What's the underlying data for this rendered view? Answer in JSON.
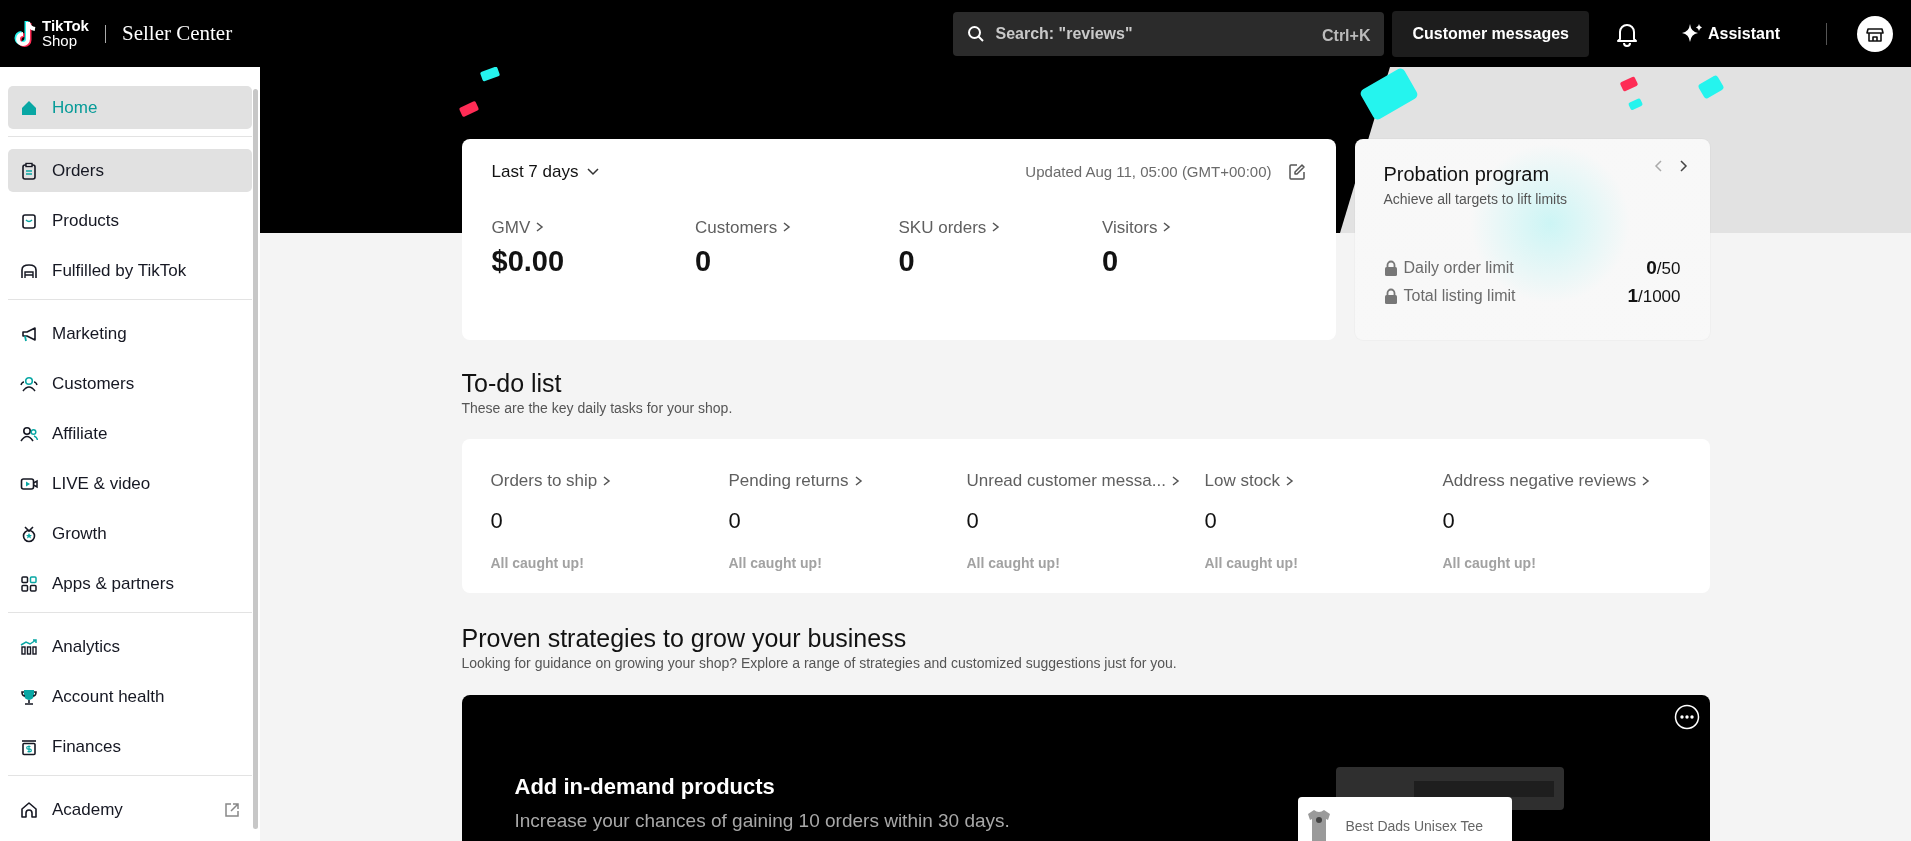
{
  "header": {
    "logo_line_1": "TikTok",
    "logo_line_2": "Shop",
    "product": "Seller Center",
    "search": {
      "placeholder": "Search: \"reviews\"",
      "shortcut": "Ctrl+K"
    },
    "messages_button": "Customer messages",
    "assistant_button": "Assistant"
  },
  "sidebar": {
    "groups": [
      [
        {
          "label": "Home",
          "kind": "home",
          "selected": true,
          "hovered": true
        }
      ],
      [
        {
          "label": "Orders",
          "kind": "orders",
          "selected": false,
          "hovered": true
        },
        {
          "label": "Products",
          "kind": "products",
          "selected": false,
          "hovered": false
        },
        {
          "label": "Fulfilled by TikTok",
          "kind": "warehouse",
          "selected": false,
          "hovered": false
        }
      ],
      [
        {
          "label": "Marketing",
          "kind": "marketing",
          "selected": false,
          "hovered": false
        },
        {
          "label": "Customers",
          "kind": "customers",
          "selected": false,
          "hovered": false
        },
        {
          "label": "Affiliate",
          "kind": "affiliate",
          "selected": false,
          "hovered": false
        },
        {
          "label": "LIVE & video",
          "kind": "video",
          "selected": false,
          "hovered": false
        },
        {
          "label": "Growth",
          "kind": "growth",
          "selected": false,
          "hovered": false
        },
        {
          "label": "Apps & partners",
          "kind": "apps",
          "selected": false,
          "hovered": false
        }
      ],
      [
        {
          "label": "Analytics",
          "kind": "analytics",
          "selected": false,
          "hovered": false
        },
        {
          "label": "Account health",
          "kind": "health",
          "selected": false,
          "hovered": false
        },
        {
          "label": "Finances",
          "kind": "finances",
          "selected": false,
          "hovered": false
        }
      ],
      [
        {
          "label": "Academy",
          "kind": "academy",
          "selected": false,
          "hovered": false,
          "external": true
        }
      ]
    ]
  },
  "stats": {
    "period": "Last 7 days",
    "updated": "Updated Aug 11, 05:00 (GMT+00:00)",
    "metrics": [
      {
        "label": "GMV",
        "value": "$0.00"
      },
      {
        "label": "Customers",
        "value": "0"
      },
      {
        "label": "SKU orders",
        "value": "0"
      },
      {
        "label": "Visitors",
        "value": "0"
      }
    ]
  },
  "probation": {
    "title": "Probation program",
    "subtitle": "Achieve all targets to lift limits",
    "limits": [
      {
        "label": "Daily order limit",
        "current": "0",
        "max": "/50"
      },
      {
        "label": "Total listing limit",
        "current": "1",
        "max": "/1000"
      }
    ]
  },
  "todo": {
    "title": "To-do list",
    "subtitle": "These are the key daily tasks for your shop.",
    "items": [
      {
        "label": "Orders to ship",
        "value": "0",
        "status": "All caught up!"
      },
      {
        "label": "Pending returns",
        "value": "0",
        "status": "All caught up!"
      },
      {
        "label": "Unread customer messa...",
        "value": "0",
        "status": "All caught up!"
      },
      {
        "label": "Low stock",
        "value": "0",
        "status": "All caught up!"
      },
      {
        "label": "Address negative reviews",
        "value": "0",
        "status": "All caught up!"
      }
    ]
  },
  "strategies": {
    "title": "Proven strategies to grow your business",
    "subtitle": "Looking for guidance on growing your shop? Explore a range of strategies and customized suggestions just for you.",
    "banner": {
      "title": "Add in-demand products",
      "subtitle": "Increase your chances of gaining 10 orders within 30 days.",
      "product_name": "Best Dads Unisex Tee"
    }
  }
}
